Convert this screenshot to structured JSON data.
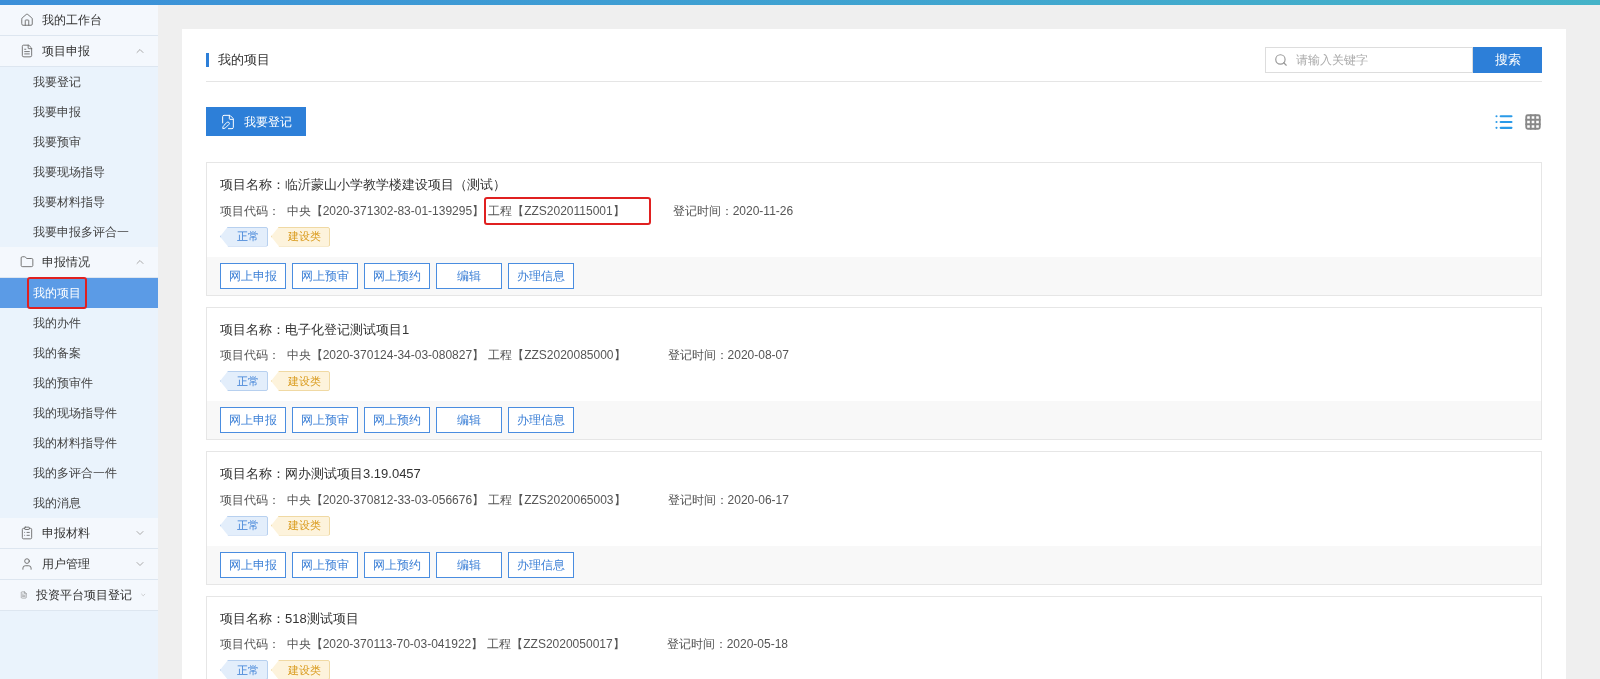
{
  "sidebar": {
    "items": [
      {
        "kind": "home",
        "label": "我的工作台"
      },
      {
        "kind": "report",
        "label": "项目申报",
        "expanded": true,
        "children": [
          {
            "label": "我要登记",
            "selected": false,
            "annotated": false
          },
          {
            "label": "我要申报",
            "selected": false,
            "annotated": false
          },
          {
            "label": "我要预审",
            "selected": false,
            "annotated": false
          },
          {
            "label": "我要现场指导",
            "selected": false,
            "annotated": false
          },
          {
            "label": "我要材料指导",
            "selected": false,
            "annotated": false
          },
          {
            "label": "我要申报多评合一",
            "selected": false,
            "annotated": false
          }
        ]
      },
      {
        "kind": "folder",
        "label": "申报情况",
        "expanded": true,
        "children": [
          {
            "label": "我的项目",
            "selected": true,
            "annotated": true
          },
          {
            "label": "我的办件",
            "selected": false,
            "annotated": false
          },
          {
            "label": "我的备案",
            "selected": false,
            "annotated": false
          },
          {
            "label": "我的预审件",
            "selected": false,
            "annotated": false
          },
          {
            "label": "我的现场指导件",
            "selected": false,
            "annotated": false
          },
          {
            "label": "我的材料指导件",
            "selected": false,
            "annotated": false
          },
          {
            "label": "我的多评合一件",
            "selected": false,
            "annotated": false
          },
          {
            "label": "我的消息",
            "selected": false,
            "annotated": false
          }
        ]
      },
      {
        "kind": "material",
        "label": "申报材料",
        "expanded": false
      },
      {
        "kind": "user",
        "label": "用户管理",
        "expanded": false
      },
      {
        "kind": "report",
        "label": "投资平台项目登记",
        "expanded": false
      }
    ]
  },
  "page_title": "我的项目",
  "search": {
    "placeholder": "请输入关键字",
    "button": "搜索"
  },
  "register_button": "我要登记",
  "view_modes": [
    {
      "kind": "list",
      "selected": true
    },
    {
      "kind": "grid",
      "selected": false
    }
  ],
  "projects": [
    {
      "name": "项目名称：临沂蒙山小学教学楼建设项目（测试）",
      "code": "项目代码：  中央【2020-371302-83-01-139295】",
      "engineering_code": "工程【ZZS2020115001】",
      "annotated": true,
      "date": "登记时间：2020-11-26",
      "tags": [
        {
          "kind": "status",
          "label": "正常"
        },
        {
          "kind": "category",
          "label": "建设类"
        }
      ],
      "actions": [
        "网上申报",
        "网上预审",
        "网上预约",
        "编辑",
        "办理信息"
      ]
    },
    {
      "name": "项目名称：电子化登记测试项目1",
      "code": "项目代码：  中央【2020-370124-34-03-080827】",
      "engineering_code": "工程【ZZS2020085000】",
      "annotated": false,
      "date": "登记时间：2020-08-07",
      "tags": [
        {
          "kind": "status",
          "label": "正常"
        },
        {
          "kind": "category",
          "label": "建设类"
        }
      ],
      "actions": [
        "网上申报",
        "网上预审",
        "网上预约",
        "编辑",
        "办理信息"
      ]
    },
    {
      "name": "项目名称：网办测试项目3.19.0457",
      "code": "项目代码：  中央【2020-370812-33-03-056676】",
      "engineering_code": "工程【ZZS2020065003】",
      "annotated": false,
      "date": "登记时间：2020-06-17",
      "tags": [
        {
          "kind": "status",
          "label": "正常"
        },
        {
          "kind": "category",
          "label": "建设类"
        }
      ],
      "actions": [
        "网上申报",
        "网上预审",
        "网上预约",
        "编辑",
        "办理信息"
      ]
    },
    {
      "name": "项目名称：518测试项目",
      "code": "项目代码：  中央【2020-370113-70-03-041922】",
      "engineering_code": "工程【ZZS2020050017】",
      "annotated": false,
      "date": "登记时间：2020-05-18",
      "tags": [
        {
          "kind": "status",
          "label": "正常"
        },
        {
          "kind": "category",
          "label": "建设类"
        }
      ]
    }
  ]
}
